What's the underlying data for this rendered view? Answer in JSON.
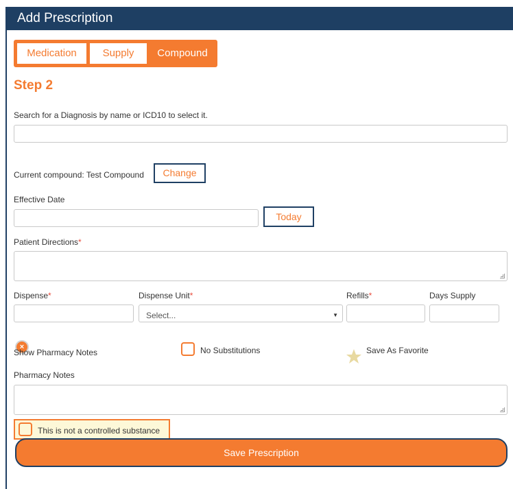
{
  "window": {
    "title": "Add Prescription"
  },
  "tabs": [
    {
      "label": "Medication"
    },
    {
      "label": "Supply"
    },
    {
      "label": "Compound"
    }
  ],
  "step_title": "Step 2",
  "diagnosis": {
    "label": "Search for a Diagnosis by name or ICD10 to select it.",
    "value": ""
  },
  "compound": {
    "label": "Current compound: Test Compound",
    "change_label": "Change"
  },
  "effective_date": {
    "label": "Effective Date",
    "value": "",
    "today_label": "Today"
  },
  "patient_directions": {
    "label": "Patient Directions",
    "required": "*",
    "value": ""
  },
  "dispense": {
    "label": "Dispense",
    "required": "*",
    "value": ""
  },
  "dispense_unit": {
    "label": "Dispense Unit",
    "required": "*",
    "selected": "Select...",
    "arrow": "▼"
  },
  "refills": {
    "label": "Refills",
    "required": "*",
    "value": ""
  },
  "days_supply": {
    "label": "Days Supply",
    "value": ""
  },
  "options": {
    "show_pharmacy_notes": {
      "label": "Show Pharmacy Notes",
      "icon": "x-circle-icon",
      "glyph": "×"
    },
    "no_substitutions": {
      "label": "No Substitutions",
      "checked": false
    },
    "save_as_favorite": {
      "label": "Save As Favorite",
      "icon": "star-icon"
    }
  },
  "pharmacy_notes": {
    "label": "Pharmacy Notes",
    "value": ""
  },
  "controlled_notice": {
    "label": "This is not a controlled substance",
    "checked": false
  },
  "save_button": {
    "label": "Save Prescription"
  },
  "colors": {
    "header": "#1e3f63",
    "accent": "#f47b30",
    "required": "#e84c3d",
    "notice_bg": "#fdf8d8",
    "star": "#e8d9a0"
  }
}
